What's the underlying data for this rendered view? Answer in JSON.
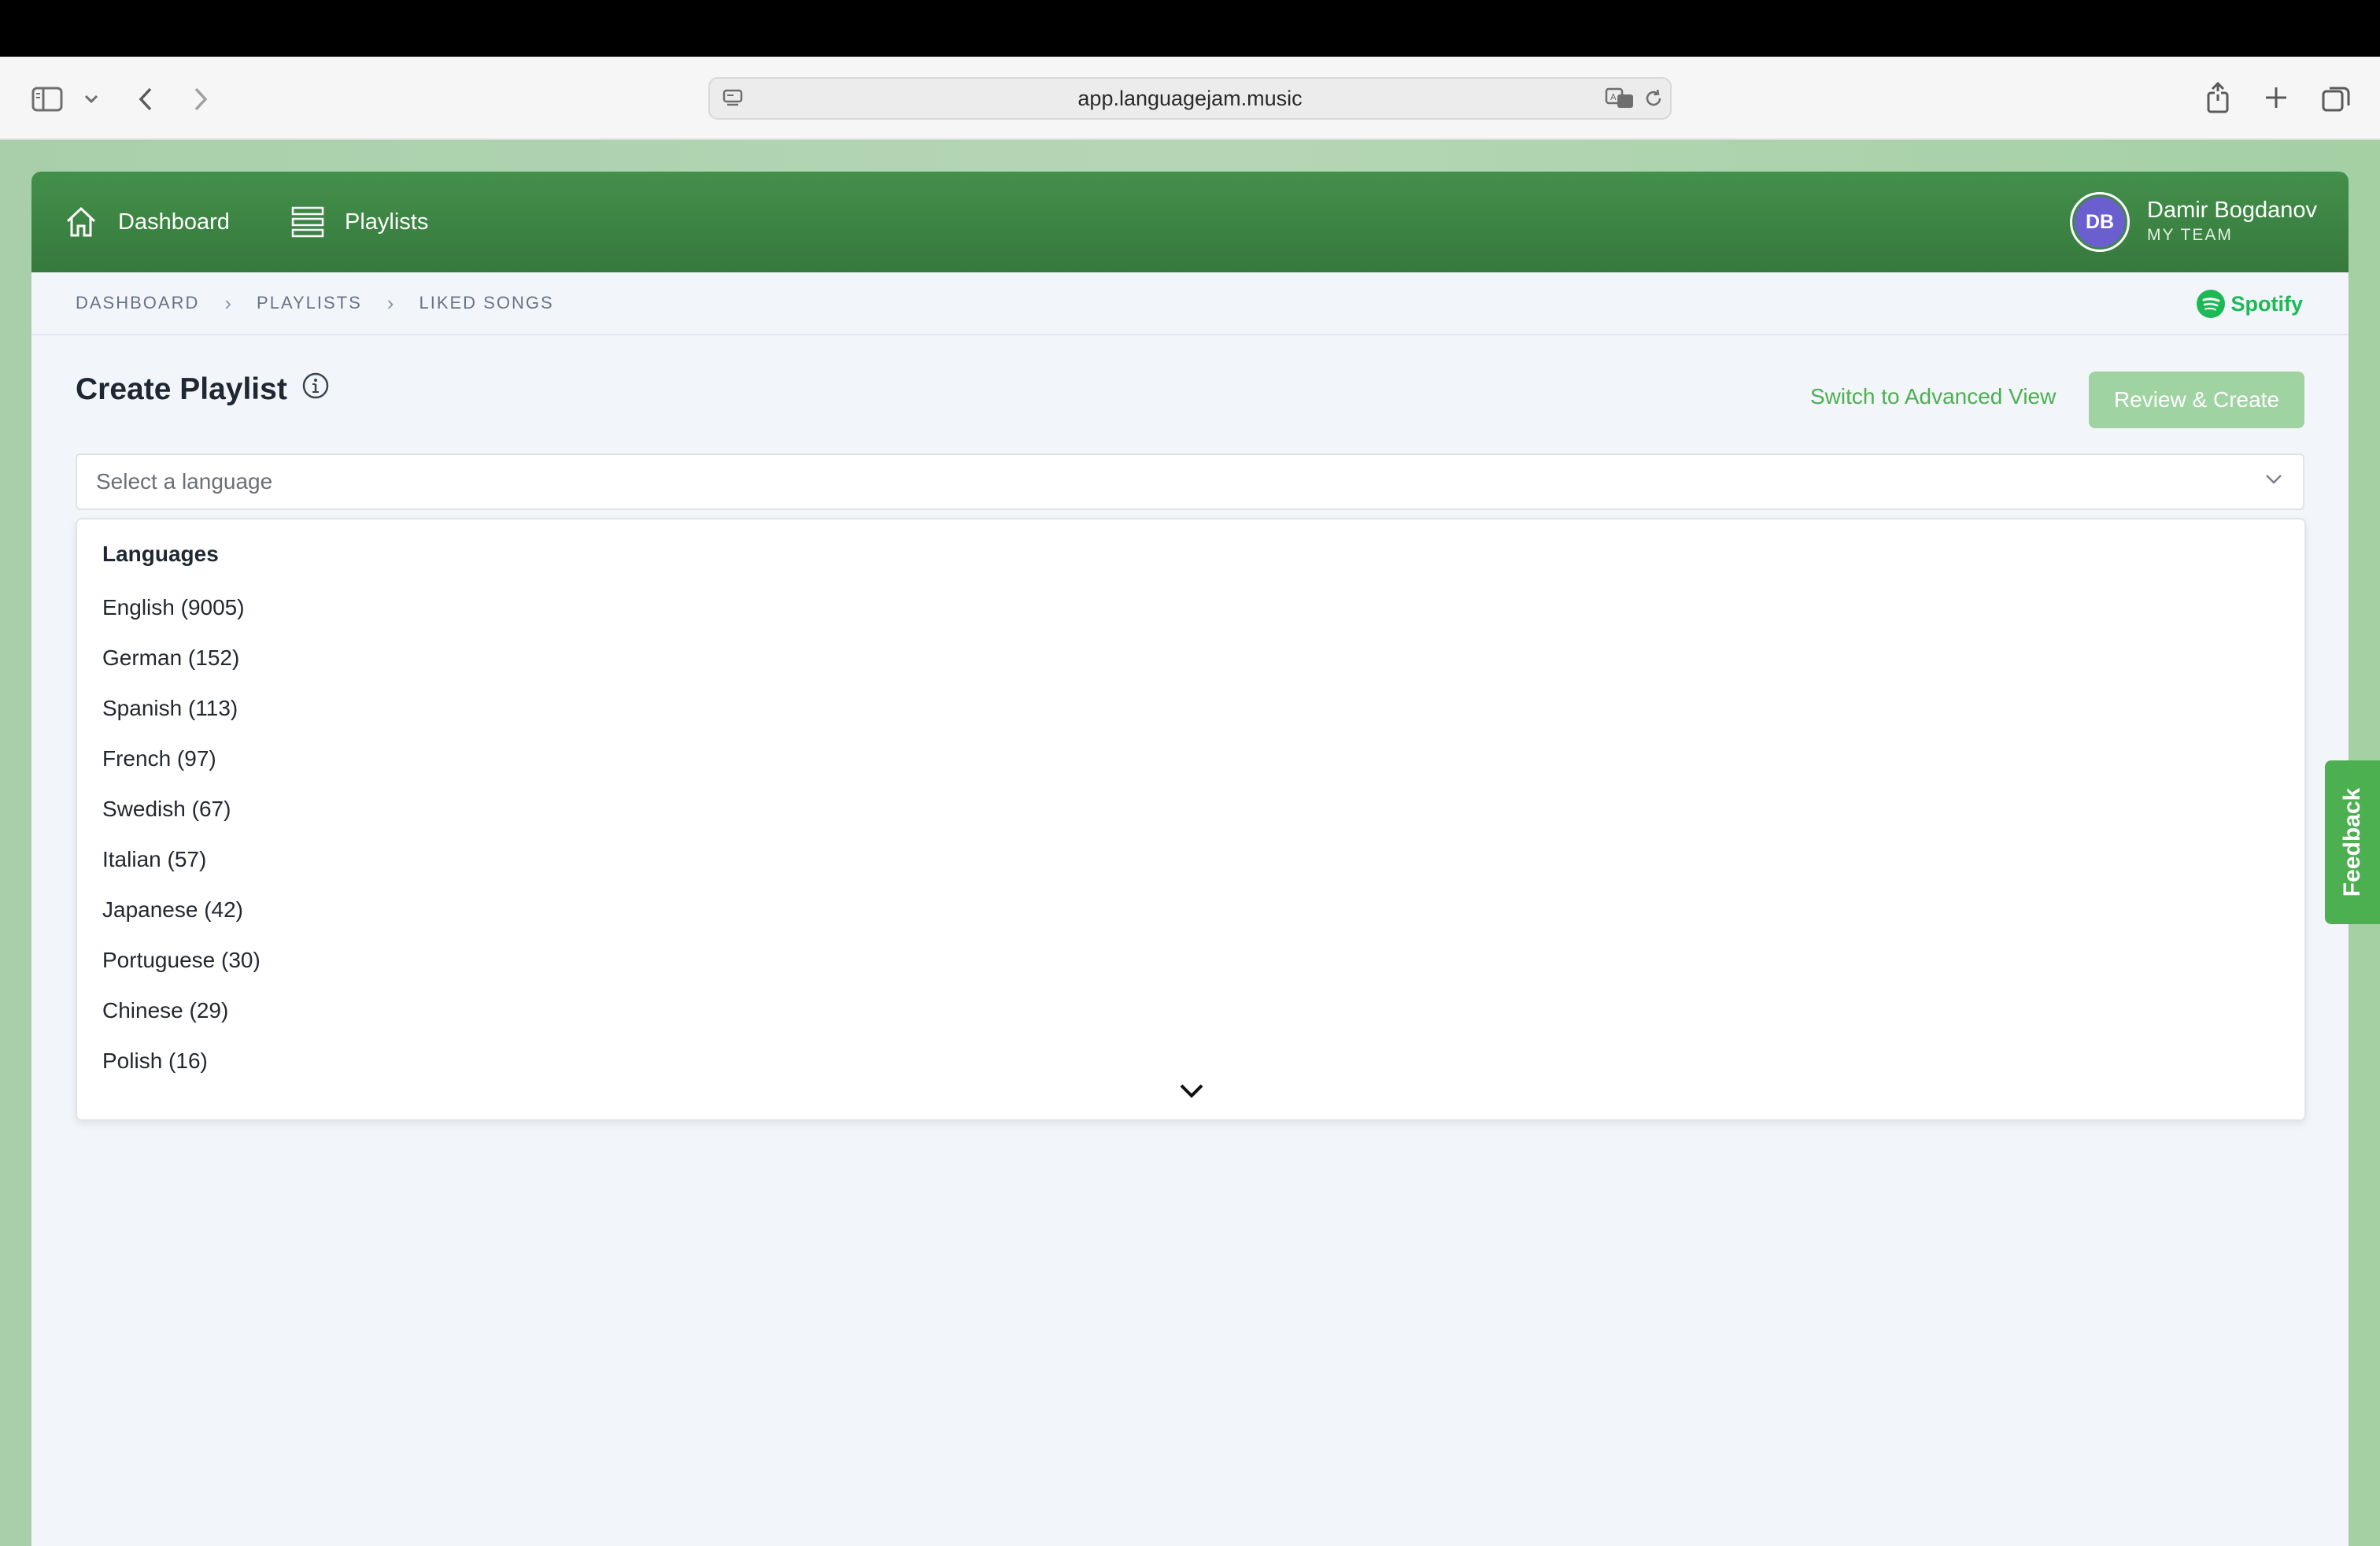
{
  "browser": {
    "url": "app.languagejam.music"
  },
  "header": {
    "nav": [
      {
        "label": "Dashboard",
        "icon": "home-icon"
      },
      {
        "label": "Playlists",
        "icon": "list-icon"
      }
    ],
    "user": {
      "initials": "DB",
      "name": "Damir Bogdanov",
      "team": "MY TEAM"
    }
  },
  "breadcrumb": [
    "DASHBOARD",
    "PLAYLISTS",
    "LIKED SONGS"
  ],
  "brand": {
    "label": "Spotify",
    "color": "#1db954"
  },
  "page": {
    "title": "Create Playlist",
    "advanced_link": "Switch to Advanced View",
    "review_button": "Review & Create"
  },
  "select": {
    "placeholder": "Select a language"
  },
  "dropdown": {
    "header": "Languages",
    "options": [
      "English (9005)",
      "German (152)",
      "Spanish (113)",
      "French (97)",
      "Swedish (67)",
      "Italian (57)",
      "Japanese (42)",
      "Portuguese (30)",
      "Chinese (29)",
      "Polish (16)"
    ]
  },
  "feedback": {
    "label": "Feedback"
  },
  "colors": {
    "header_green": "#3d8643",
    "accent": "#4caf50",
    "avatar": "#6b5fd0"
  }
}
